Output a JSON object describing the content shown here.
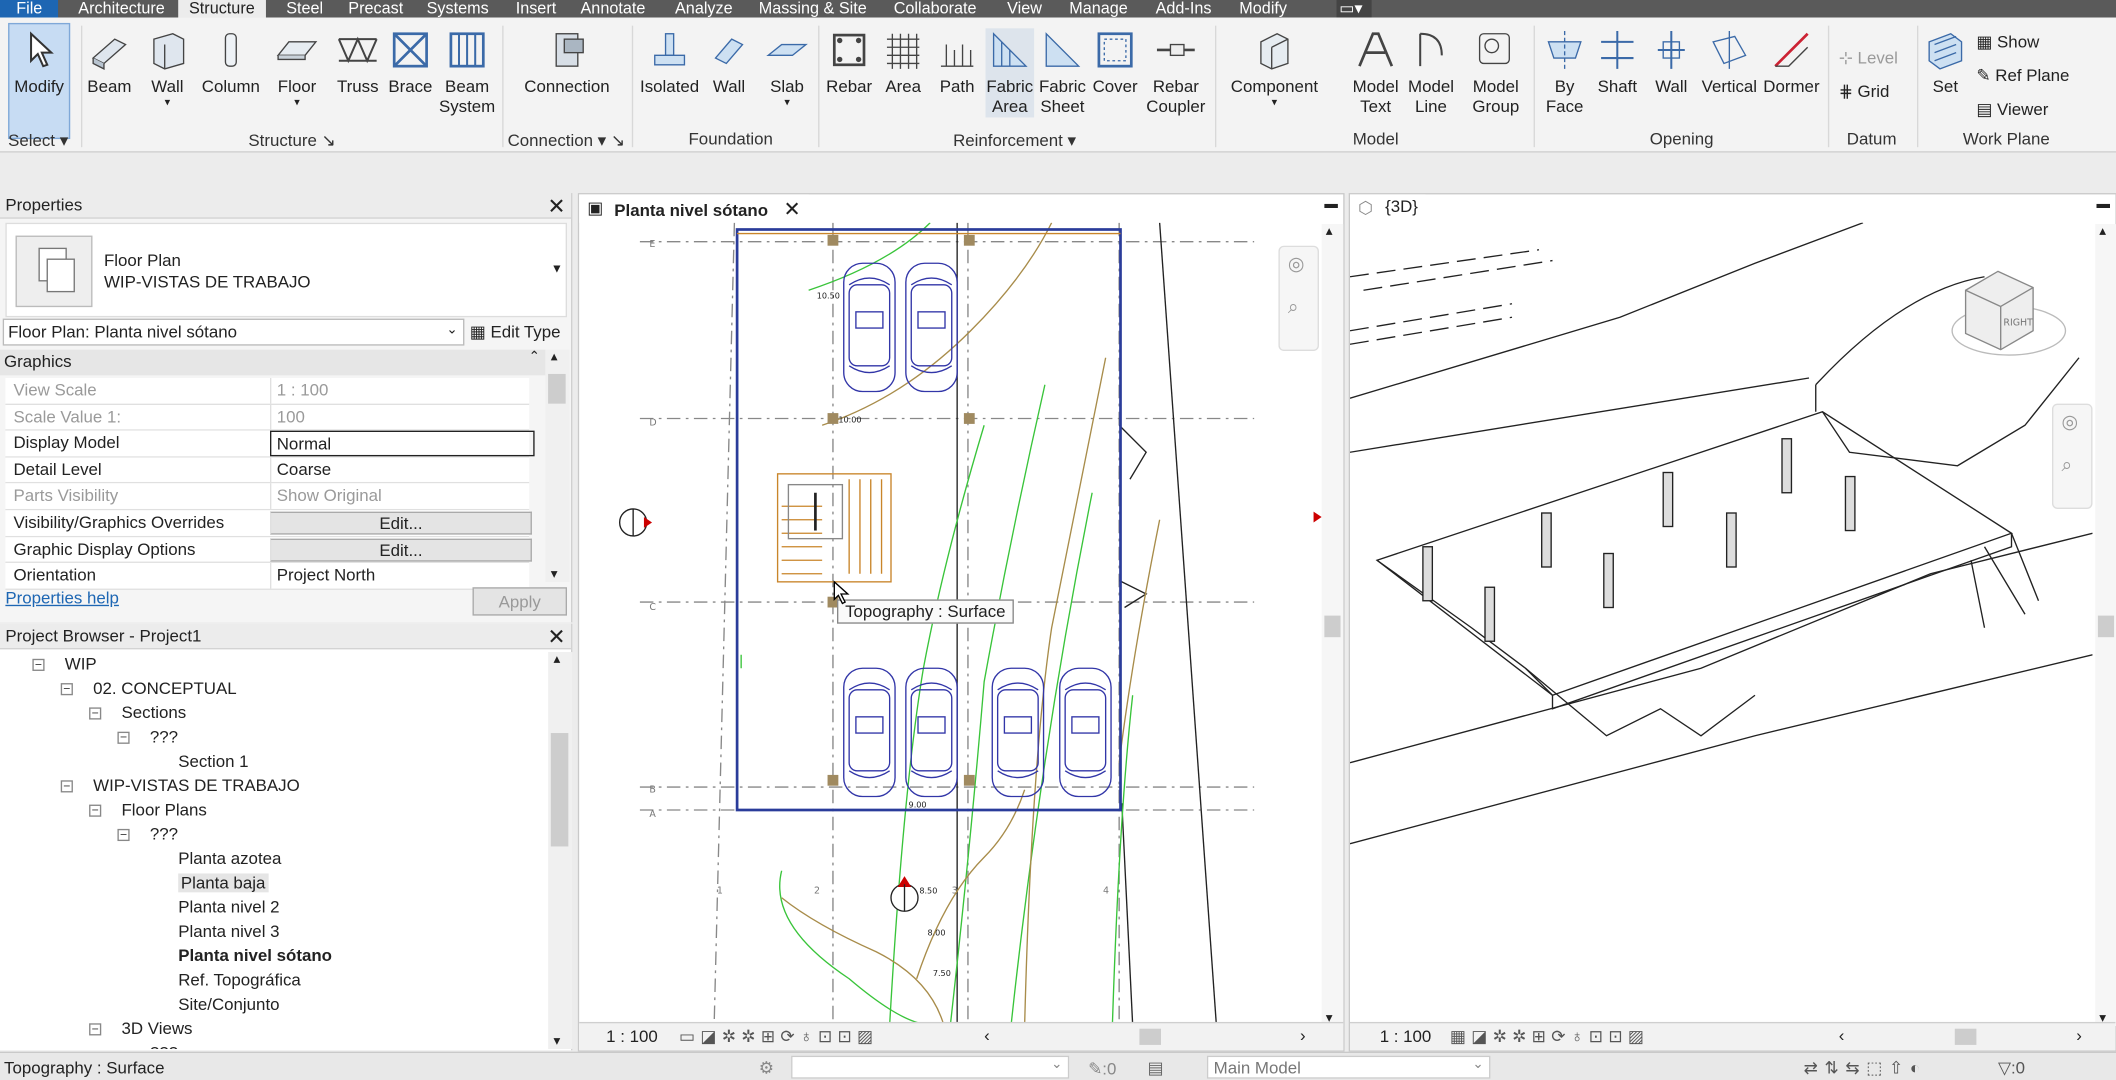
{
  "menu": {
    "file": "File",
    "tabs": [
      "Architecture",
      "Structure",
      "Steel",
      "Precast",
      "Systems",
      "Insert",
      "Annotate",
      "Analyze",
      "Massing & Site",
      "Collaborate",
      "View",
      "Manage",
      "Add-Ins",
      "Modify"
    ],
    "active": "Structure"
  },
  "ribbon": {
    "modify": "Modify",
    "select": "Select ▾",
    "structure": {
      "label": "Structure ↘",
      "beam": "Beam",
      "wall": "Wall",
      "column": "Column",
      "floor": "Floor",
      "truss": "Truss",
      "brace": "Brace",
      "beam_system": [
        "Beam",
        "System"
      ]
    },
    "connection": {
      "label": "Connection ▾ ↘",
      "connection": "Connection"
    },
    "foundation": {
      "label": "Foundation",
      "isolated": "Isolated",
      "wall": "Wall",
      "slab": "Slab"
    },
    "reinforcement": {
      "label": "Reinforcement ▾",
      "rebar": "Rebar",
      "area": "Area",
      "path": "Path",
      "fabric_area": [
        "Fabric",
        "Area"
      ],
      "fabric_sheet": [
        "Fabric",
        "Sheet"
      ],
      "cover": "Cover",
      "rebar_coupler": [
        "Rebar",
        "Coupler"
      ]
    },
    "model": {
      "label": "Model",
      "component": "Component",
      "model_text": [
        "Model",
        "Text"
      ],
      "model_line": [
        "Model",
        "Line"
      ],
      "model_group": [
        "Model",
        "Group"
      ]
    },
    "opening": {
      "label": "Opening",
      "by_face": [
        "By",
        "Face"
      ],
      "shaft": "Shaft",
      "wall": "Wall",
      "vertical": "Vertical",
      "dormer": "Dormer"
    },
    "datum": {
      "label": "Datum",
      "level": "Level",
      "grid": "Grid"
    },
    "work_plane": {
      "label": "Work Plane",
      "set": "Set",
      "show": "Show",
      "ref_plane": "Ref  Plane",
      "viewer": "Viewer"
    }
  },
  "properties": {
    "title": "Properties",
    "type_name": "Floor Plan",
    "type_sub": "WIP-VISTAS DE TRABAJO",
    "selector": "Floor Plan: Planta nivel sótano",
    "edit_type": "Edit Type",
    "group": "Graphics",
    "rows": [
      {
        "k": "View Scale",
        "v": "1 : 100",
        "dim": true
      },
      {
        "k": "Scale Value    1:",
        "v": "100",
        "dim": true
      },
      {
        "k": "Display Model",
        "v": "Normal"
      },
      {
        "k": "Detail Level",
        "v": "Coarse"
      },
      {
        "k": "Parts Visibility",
        "v": "Show Original",
        "dim": true
      },
      {
        "k": "Visibility/Graphics Overrides",
        "v": "Edit...",
        "button": true
      },
      {
        "k": "Graphic Display Options",
        "v": "Edit...",
        "button": true
      },
      {
        "k": "Orientation",
        "v": "Project North"
      }
    ],
    "help": "Properties help",
    "apply": "Apply"
  },
  "browser": {
    "title": "Project Browser - Project1",
    "items": [
      {
        "t": "WIP",
        "l": 0,
        "e": "−"
      },
      {
        "t": "02. CONCEPTUAL",
        "l": 1,
        "e": "−"
      },
      {
        "t": "Sections",
        "l": 2,
        "e": "−"
      },
      {
        "t": "???",
        "l": 3,
        "e": "−"
      },
      {
        "t": "Section 1",
        "l": 4
      },
      {
        "t": "WIP-VISTAS DE TRABAJO",
        "l": 1,
        "e": "−"
      },
      {
        "t": "Floor Plans",
        "l": 2,
        "e": "−"
      },
      {
        "t": "???",
        "l": 3,
        "e": "−"
      },
      {
        "t": "Planta azotea",
        "l": 4
      },
      {
        "t": "Planta baja",
        "l": 4,
        "hl": true
      },
      {
        "t": "Planta nivel 2",
        "l": 4
      },
      {
        "t": "Planta nivel 3",
        "l": 4
      },
      {
        "t": "Planta nivel sótano",
        "l": 4,
        "bold": true
      },
      {
        "t": "Ref. Topográfica",
        "l": 4
      },
      {
        "t": "Site/Conjunto",
        "l": 4
      },
      {
        "t": "3D Views",
        "l": 2,
        "e": "−"
      },
      {
        "t": "???",
        "l": 3
      }
    ]
  },
  "plan": {
    "tab": "Planta nivel sótano",
    "scale": "1 : 100",
    "tooltip": "Topography : Surface",
    "elev": {
      "e1": "10.50",
      "e2": "10.00",
      "e3": "9.00",
      "e4": "8.50",
      "e5": "8.00",
      "e6": "7.50"
    },
    "grid": {
      "r1": "E",
      "r2": "D",
      "r3": "C",
      "r4": "B",
      "r5": "A",
      "c1": "1",
      "c2": "2",
      "c3": "3",
      "c4": "4"
    }
  },
  "view3d": {
    "tab": "{3D}",
    "scale": "1 : 100",
    "cube": "RIGHT"
  },
  "status": {
    "text": "Topography : Surface",
    "worksets": ":0",
    "model": "Main Model",
    "filter": ":0"
  }
}
